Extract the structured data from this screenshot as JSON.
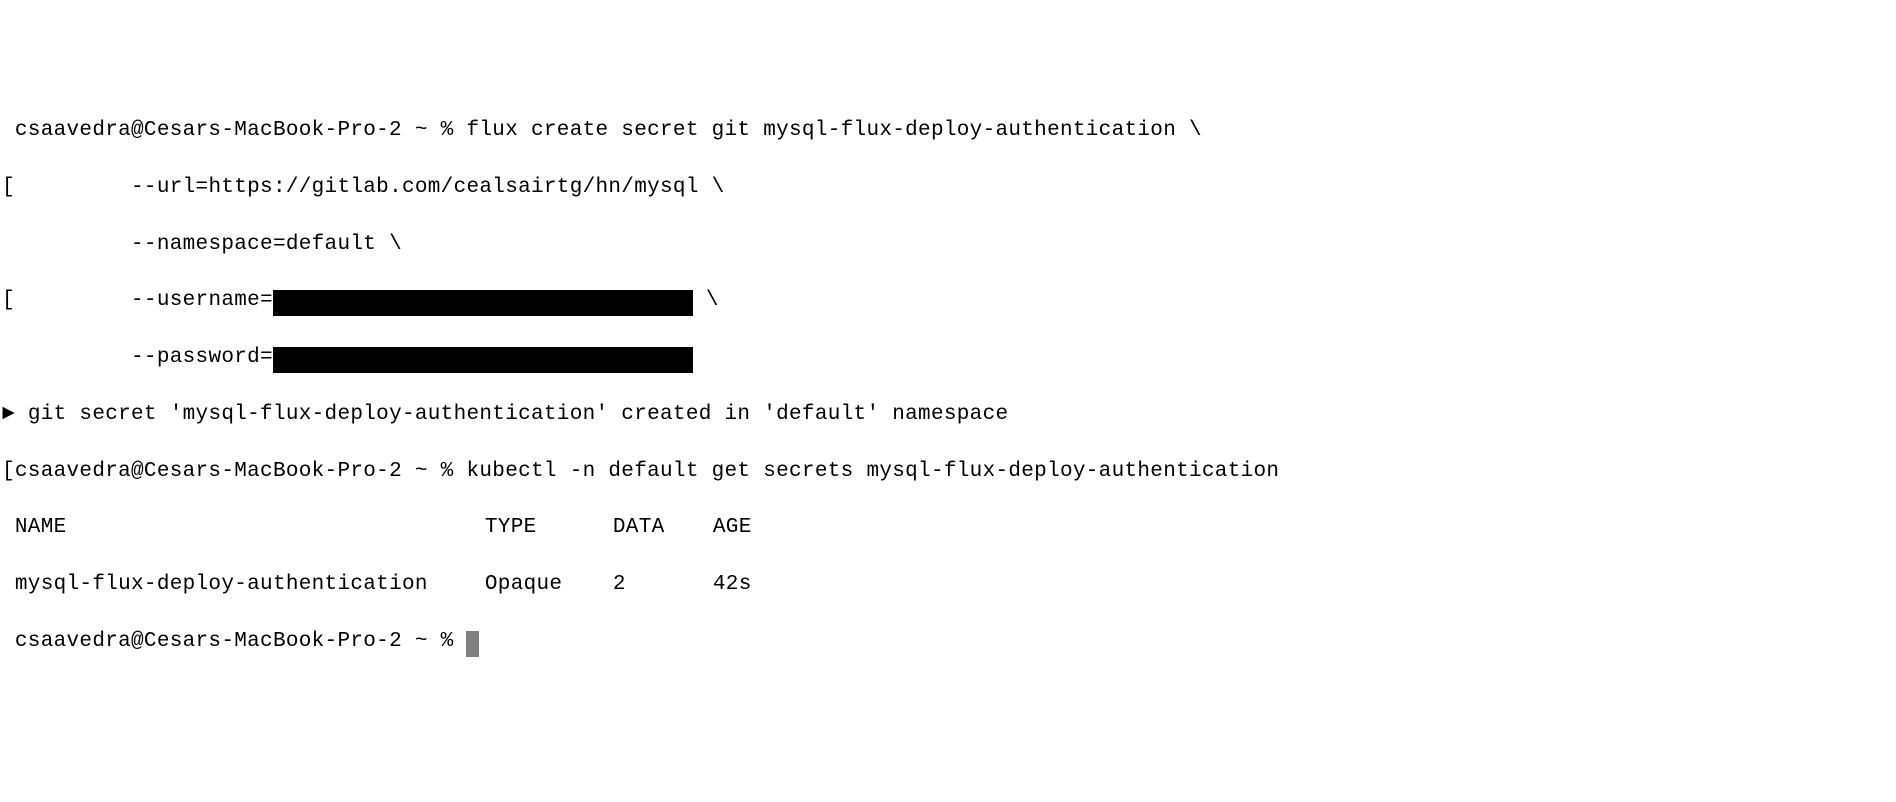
{
  "prompt": {
    "user_host": "csaavedra@Cesars-MacBook-Pro-2",
    "path_sep": "~",
    "symbol": "%"
  },
  "command1": {
    "line1_prefix": " csaavedra@Cesars-MacBook-Pro-2 ~ % ",
    "line1_cmd": "flux create secret git mysql-flux-deploy-authentication \\",
    "line2_prefix": "[         ",
    "line2_cmd": "--url=https://gitlab.com/cealsairtg/hn/mysql \\",
    "line3_prefix": "          ",
    "line3_cmd": "--namespace=default \\",
    "line4_prefix": "[         ",
    "line4_label": "--username=",
    "line4_suffix": " \\",
    "line5_prefix": "          ",
    "line5_label": "--password="
  },
  "output1": {
    "marker": "► ",
    "text": "git secret 'mysql-flux-deploy-authentication' created in 'default' namespace"
  },
  "command2": {
    "prefix": "[",
    "prompt": "csaavedra@Cesars-MacBook-Pro-2 ~ % ",
    "cmd": "kubectl -n default get secrets mysql-flux-deploy-authentication"
  },
  "table": {
    "headers": {
      "name": "NAME",
      "type": "TYPE",
      "data": "DATA",
      "age": "AGE"
    },
    "row": {
      "name": "mysql-flux-deploy-authentication",
      "type": "Opaque",
      "data": "2",
      "age": "42s"
    }
  },
  "final_prompt": {
    "prefix": " ",
    "text": "csaavedra@Cesars-MacBook-Pro-2 ~ % "
  }
}
